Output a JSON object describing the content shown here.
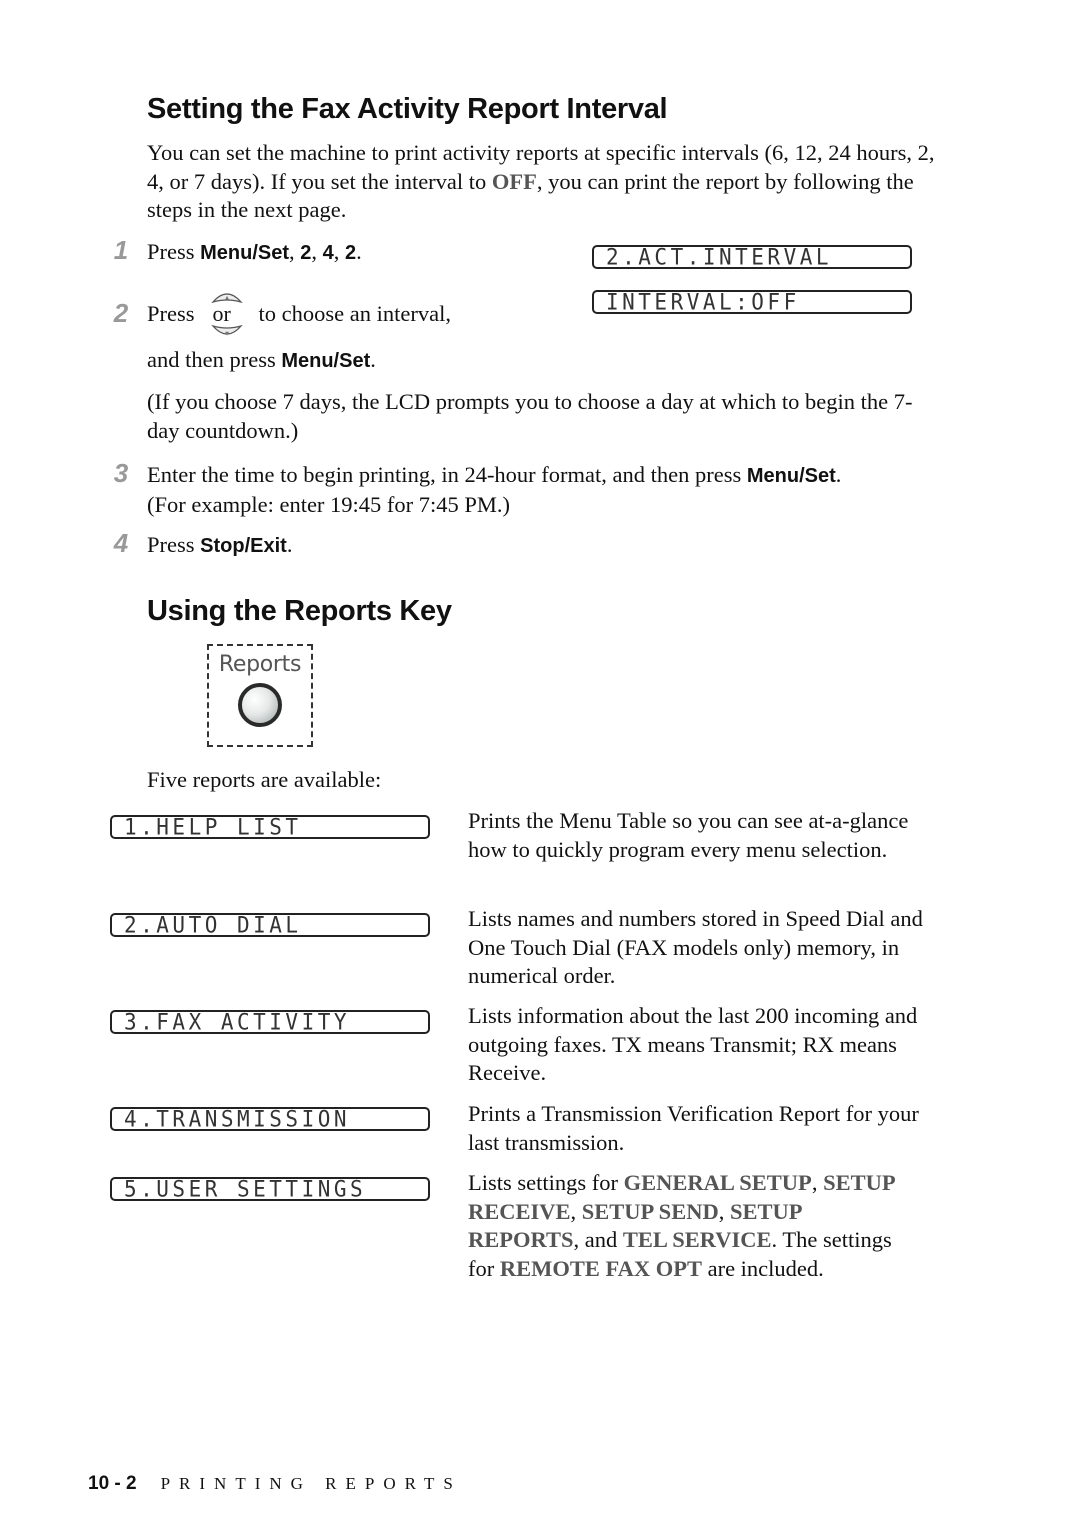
{
  "section1": {
    "title": "Setting the Fax Activity Report Interval",
    "intro": {
      "part1": "You can set the machine to print activity reports at specific intervals (6, 12, 24 hours, 2, 4, or 7 days). If you set the interval to ",
      "highlight": "OFF",
      "part2": ", you can print the report by following the steps in the next page."
    },
    "steps": [
      {
        "number": "1",
        "text_pre": "Press ",
        "bold": "Menu/Set",
        "text_mid1": ", ",
        "bold2": "2",
        "text_mid2": ", ",
        "bold3": "4",
        "text_mid3": ", ",
        "bold4": "2",
        "text_post": "."
      },
      {
        "number": "2",
        "text_pre": "Press",
        "key_icon": "up-down-arrow-keys",
        "key_label": "or",
        "text_mid": "to choose an interval,",
        "line2_pre": "and then press ",
        "line2_bold": "Menu/Set",
        "line2_post": ".",
        "note": "(If you choose 7 days, the LCD prompts you to choose a day at which to begin the 7-day countdown.)"
      },
      {
        "number": "3",
        "text_pre": "Enter the time to begin printing, in 24-hour format, and then press ",
        "bold": "Menu/Set",
        "text_post": ".",
        "line2": "(For example: enter 19:45 for 7:45 PM.)"
      },
      {
        "number": "4",
        "text_pre": "Press ",
        "bold": "Stop/Exit",
        "text_post": "."
      }
    ],
    "lcd": [
      "2.ACT.INTERVAL",
      "INTERVAL:OFF"
    ]
  },
  "section2": {
    "title": "Using the Reports Key",
    "key_label": "Reports",
    "available_text": "Five reports are available:",
    "reports": [
      {
        "lcd": "1.HELP LIST",
        "description": "Prints the Menu Table so you can see at-a-glance how to quickly program every menu selection."
      },
      {
        "lcd": "2.AUTO DIAL",
        "description": "Lists names and numbers stored in Speed Dial and One Touch Dial (FAX models only) memory, in numerical order."
      },
      {
        "lcd": "3.FAX ACTIVITY",
        "description": "Lists information about the last 200 incoming and outgoing faxes. TX means Transmit; RX means Receive."
      },
      {
        "lcd": "4.TRANSMISSION",
        "description": "Prints a Transmission Verification Report for your last transmission."
      },
      {
        "lcd": "5.USER SETTINGS",
        "description_parts": {
          "p1": "Lists settings for ",
          "h1": "GENERAL SETUP",
          "p2": ", ",
          "h2": "SETUP RECEIVE",
          "p3": ", ",
          "h3": "SETUP SEND",
          "p4": ", ",
          "h4": "SETUP REPORTS",
          "p5": ", and ",
          "h5": "TEL SERVICE",
          "p6": ". The settings for ",
          "h6": "REMOTE FAX OPT",
          "p7": " are included."
        }
      }
    ]
  },
  "footer": {
    "page_number": "10 - 2",
    "chapter_title": "PRINTING REPORTS"
  }
}
